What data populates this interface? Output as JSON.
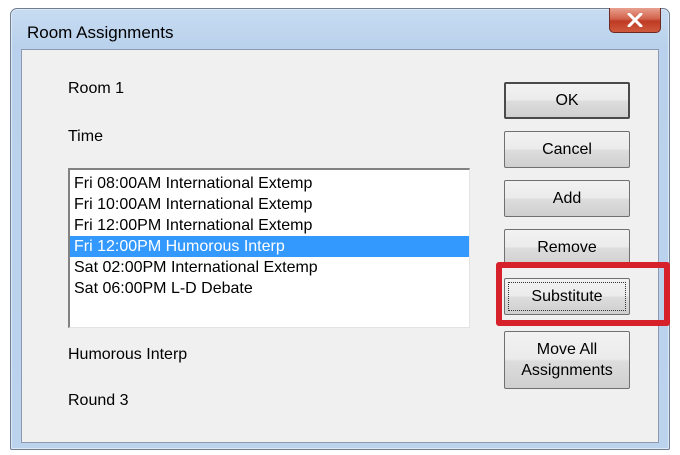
{
  "window": {
    "title": "Room Assignments",
    "close_icon": "close-icon"
  },
  "labels": {
    "room": "Room 1",
    "time": "Time",
    "event": "Humorous Interp",
    "round": "Round 3"
  },
  "time_list": {
    "items": [
      "Fri 08:00AM International Extemp",
      "Fri 10:00AM International Extemp",
      "Fri 12:00PM International Extemp",
      "Fri 12:00PM Humorous Interp",
      "Sat 02:00PM International Extemp",
      "Sat 06:00PM L-D Debate"
    ],
    "selected_index": 3
  },
  "buttons": {
    "ok": "OK",
    "cancel": "Cancel",
    "add": "Add",
    "remove": "Remove",
    "substitute": "Substitute",
    "move_all": "Move All\nAssignments"
  },
  "colors": {
    "selection": "#3399ff",
    "highlight_box": "#d6202a",
    "close_button": "#c9452e"
  }
}
